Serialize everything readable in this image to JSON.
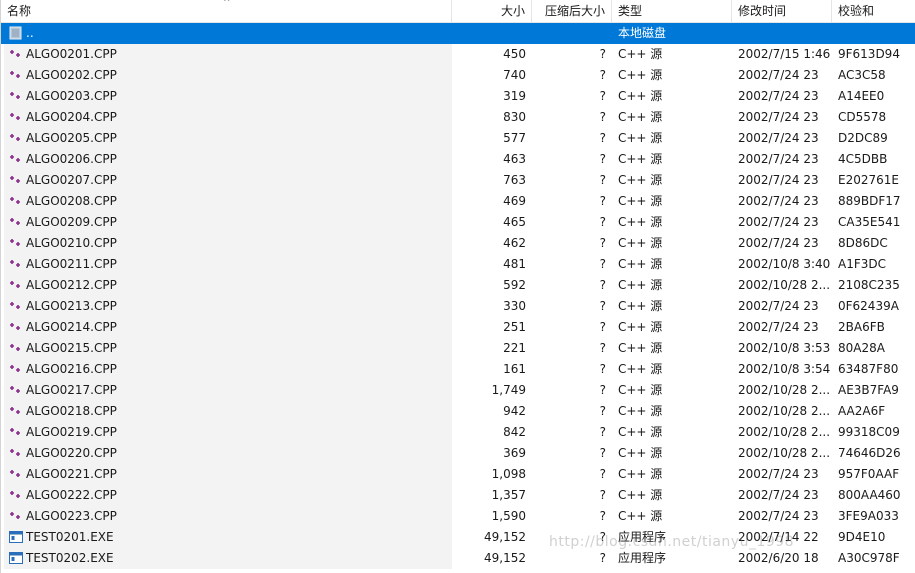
{
  "columns": {
    "name": "名称",
    "size": "大小",
    "compressed": "压缩后大小",
    "type": "类型",
    "modified": "修改时间",
    "checksum": "校验和"
  },
  "sort_indicator": "^",
  "parent_row": {
    "name": "..",
    "type": "本地磁盘",
    "icon": "parent-folder-icon"
  },
  "files": [
    {
      "name": "ALGO0201.CPP",
      "size": "450",
      "compressed": "?",
      "type": "C++ 源",
      "modified": "2002/7/15 1:46",
      "checksum": "9F613D94",
      "icon": "cpp-source-icon"
    },
    {
      "name": "ALGO0202.CPP",
      "size": "740",
      "compressed": "?",
      "type": "C++ 源",
      "modified": "2002/7/24 23",
      "checksum": "AC3C58",
      "icon": "cpp-source-icon"
    },
    {
      "name": "ALGO0203.CPP",
      "size": "319",
      "compressed": "?",
      "type": "C++ 源",
      "modified": "2002/7/24 23",
      "checksum": "A14EE0",
      "icon": "cpp-source-icon"
    },
    {
      "name": "ALGO0204.CPP",
      "size": "830",
      "compressed": "?",
      "type": "C++ 源",
      "modified": "2002/7/24 23",
      "checksum": "CD5578",
      "icon": "cpp-source-icon"
    },
    {
      "name": "ALGO0205.CPP",
      "size": "577",
      "compressed": "?",
      "type": "C++ 源",
      "modified": "2002/7/24 23",
      "checksum": "D2DC89",
      "icon": "cpp-source-icon"
    },
    {
      "name": "ALGO0206.CPP",
      "size": "463",
      "compressed": "?",
      "type": "C++ 源",
      "modified": "2002/7/24 23",
      "checksum": "4C5DBB",
      "icon": "cpp-source-icon"
    },
    {
      "name": "ALGO0207.CPP",
      "size": "763",
      "compressed": "?",
      "type": "C++ 源",
      "modified": "2002/7/24 23",
      "checksum": "E202761E",
      "icon": "cpp-source-icon"
    },
    {
      "name": "ALGO0208.CPP",
      "size": "469",
      "compressed": "?",
      "type": "C++ 源",
      "modified": "2002/7/24 23",
      "checksum": "889BDF17",
      "icon": "cpp-source-icon"
    },
    {
      "name": "ALGO0209.CPP",
      "size": "465",
      "compressed": "?",
      "type": "C++ 源",
      "modified": "2002/7/24 23",
      "checksum": "CA35E541",
      "icon": "cpp-source-icon"
    },
    {
      "name": "ALGO0210.CPP",
      "size": "462",
      "compressed": "?",
      "type": "C++ 源",
      "modified": "2002/7/24 23",
      "checksum": "8D86DC",
      "icon": "cpp-source-icon"
    },
    {
      "name": "ALGO0211.CPP",
      "size": "481",
      "compressed": "?",
      "type": "C++ 源",
      "modified": "2002/10/8 3:40",
      "checksum": "A1F3DC",
      "icon": "cpp-source-icon"
    },
    {
      "name": "ALGO0212.CPP",
      "size": "592",
      "compressed": "?",
      "type": "C++ 源",
      "modified": "2002/10/28 2...",
      "checksum": "2108C235",
      "icon": "cpp-source-icon"
    },
    {
      "name": "ALGO0213.CPP",
      "size": "330",
      "compressed": "?",
      "type": "C++ 源",
      "modified": "2002/7/24 23",
      "checksum": "0F62439A",
      "icon": "cpp-source-icon"
    },
    {
      "name": "ALGO0214.CPP",
      "size": "251",
      "compressed": "?",
      "type": "C++ 源",
      "modified": "2002/7/24 23",
      "checksum": "2BA6FB",
      "icon": "cpp-source-icon"
    },
    {
      "name": "ALGO0215.CPP",
      "size": "221",
      "compressed": "?",
      "type": "C++ 源",
      "modified": "2002/10/8 3:53",
      "checksum": "80A28A",
      "icon": "cpp-source-icon"
    },
    {
      "name": "ALGO0216.CPP",
      "size": "161",
      "compressed": "?",
      "type": "C++ 源",
      "modified": "2002/10/8 3:54",
      "checksum": "63487F80",
      "icon": "cpp-source-icon"
    },
    {
      "name": "ALGO0217.CPP",
      "size": "1,749",
      "compressed": "?",
      "type": "C++ 源",
      "modified": "2002/10/28 2...",
      "checksum": "AE3B7FA9",
      "icon": "cpp-source-icon"
    },
    {
      "name": "ALGO0218.CPP",
      "size": "942",
      "compressed": "?",
      "type": "C++ 源",
      "modified": "2002/10/28 2...",
      "checksum": "AA2A6F",
      "icon": "cpp-source-icon"
    },
    {
      "name": "ALGO0219.CPP",
      "size": "842",
      "compressed": "?",
      "type": "C++ 源",
      "modified": "2002/10/28 2...",
      "checksum": "99318C09",
      "icon": "cpp-source-icon"
    },
    {
      "name": "ALGO0220.CPP",
      "size": "369",
      "compressed": "?",
      "type": "C++ 源",
      "modified": "2002/10/28 2...",
      "checksum": "74646D26",
      "icon": "cpp-source-icon"
    },
    {
      "name": "ALGO0221.CPP",
      "size": "1,098",
      "compressed": "?",
      "type": "C++ 源",
      "modified": "2002/7/24 23",
      "checksum": "957F0AAF",
      "icon": "cpp-source-icon"
    },
    {
      "name": "ALGO0222.CPP",
      "size": "1,357",
      "compressed": "?",
      "type": "C++ 源",
      "modified": "2002/7/24 23",
      "checksum": "800AA460",
      "icon": "cpp-source-icon"
    },
    {
      "name": "ALGO0223.CPP",
      "size": "1,590",
      "compressed": "?",
      "type": "C++ 源",
      "modified": "2002/7/24 23",
      "checksum": "3FE9A033",
      "icon": "cpp-source-icon"
    },
    {
      "name": "TEST0201.EXE",
      "size": "49,152",
      "compressed": "?",
      "type": "应用程序",
      "modified": "2002/7/14 22",
      "checksum": "9D4E10",
      "icon": "exe-application-icon"
    },
    {
      "name": "TEST0202.EXE",
      "size": "49,152",
      "compressed": "?",
      "type": "应用程序",
      "modified": "2002/6/20 18",
      "checksum": "A30C978F",
      "icon": "exe-application-icon"
    }
  ],
  "watermark": "http://blog.csdn.net/tianyu_1998",
  "colors": {
    "selection": "#0078d7",
    "name_column_bg": "#f3f3f3",
    "cpp_icon": "#8b2b8b",
    "exe_icon": "#2a6ebb"
  }
}
